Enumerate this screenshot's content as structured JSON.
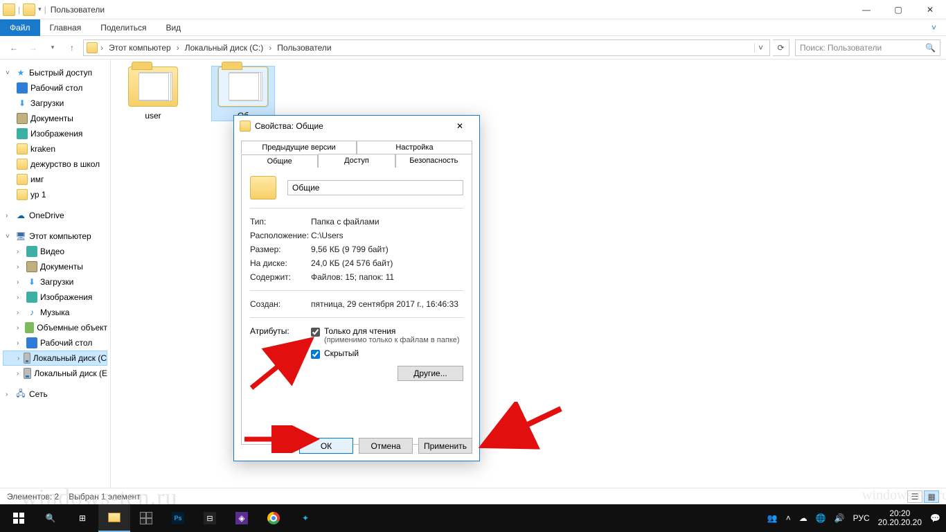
{
  "window": {
    "title": "Пользователи"
  },
  "ribbon": {
    "file": "Файл",
    "tabs": [
      "Главная",
      "Поделиться",
      "Вид"
    ]
  },
  "breadcrumbs": [
    "Этот компьютер",
    "Локальный диск (C:)",
    "Пользователи"
  ],
  "search": {
    "placeholder": "Поиск: Пользователи"
  },
  "tree": {
    "quick": "Быстрый доступ",
    "quick_items": [
      "Рабочий стол",
      "Загрузки",
      "Документы",
      "Изображения",
      "kraken",
      "дежурство в школ",
      "имг",
      "ур 1"
    ],
    "onedrive": "OneDrive",
    "thispc": "Этот компьютер",
    "pc_items": [
      "Видео",
      "Документы",
      "Загрузки",
      "Изображения",
      "Музыка",
      "Объемные объект",
      "Рабочий стол",
      "Локальный диск (C",
      "Локальный диск (E"
    ],
    "network": "Сеть"
  },
  "folders": [
    {
      "name": "user"
    },
    {
      "name": "Об"
    }
  ],
  "status": {
    "count": "Элементов: 2",
    "selected": "Выбран 1 элемент"
  },
  "dialog": {
    "title": "Свойства: Общие",
    "tabs_row1": [
      "Предыдущие версии",
      "Настройка"
    ],
    "tabs_row2": [
      "Общие",
      "Доступ",
      "Безопасность"
    ],
    "name_value": "Общие",
    "type_k": "Тип:",
    "type_v": "Папка с файлами",
    "loc_k": "Расположение:",
    "loc_v": "C:\\Users",
    "size_k": "Размер:",
    "size_v": "9,56 КБ (9 799 байт)",
    "ondisk_k": "На диске:",
    "ondisk_v": "24,0 КБ (24 576 байт)",
    "contains_k": "Содержит:",
    "contains_v": "Файлов: 15; папок: 11",
    "created_k": "Создан:",
    "created_v": "пятница, 29 сентября 2017 г., 16:46:33",
    "attr_k": "Атрибуты:",
    "readonly": "Только для чтения",
    "readonly_sub": "(применимо только к файлам в папке)",
    "hidden": "Скрытый",
    "other": "Другие...",
    "ok": "ОК",
    "cancel": "Отмена",
    "apply": "Применить"
  },
  "taskbar": {
    "time": "20:20",
    "date": "20.20.20.20",
    "lang": "РУС"
  }
}
